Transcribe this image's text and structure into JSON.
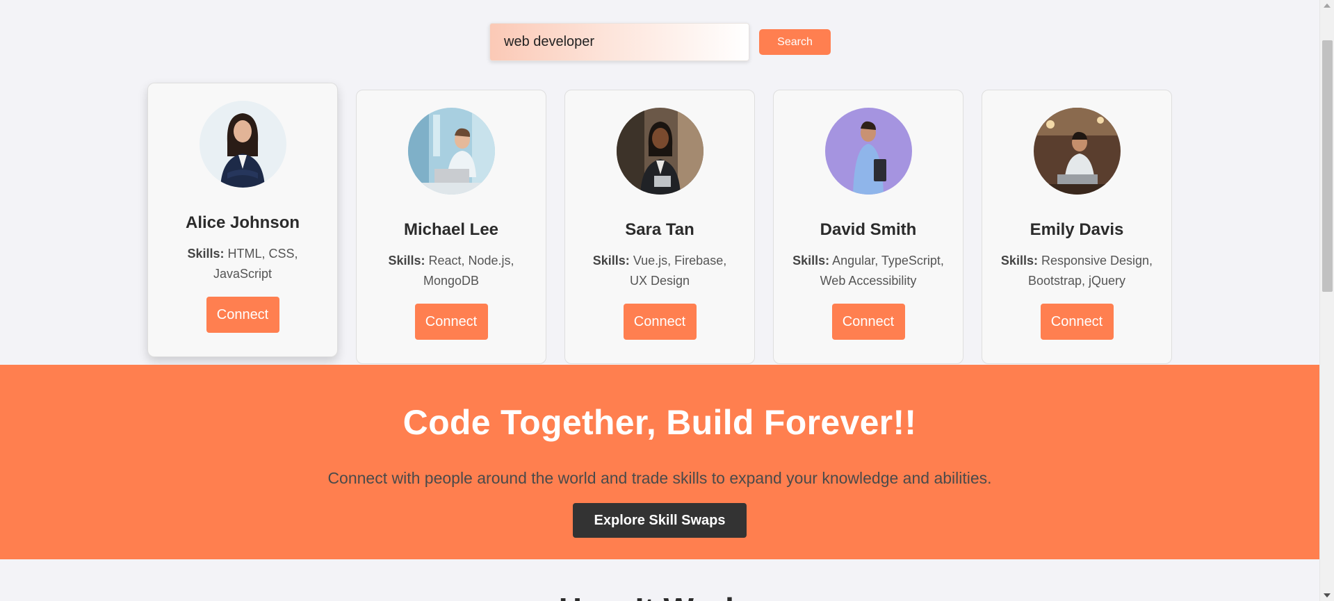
{
  "search": {
    "value": "web developer",
    "button_label": "Search"
  },
  "profiles": [
    {
      "name": "Alice Johnson",
      "skills_label": "Skills:",
      "skills": "HTML, CSS, JavaScript",
      "button_label": "Connect",
      "avatar_icon": "woman-business-suit-avatar",
      "avatar_bg": "#e9f0f4"
    },
    {
      "name": "Michael Lee",
      "skills_label": "Skills:",
      "skills": "React, Node.js, MongoDB",
      "button_label": "Connect",
      "avatar_icon": "man-laptop-office-avatar",
      "avatar_bg": "#a8cfe0"
    },
    {
      "name": "Sara Tan",
      "skills_label": "Skills:",
      "skills": "Vue.js, Firebase, UX Design",
      "button_label": "Connect",
      "avatar_icon": "woman-tablet-avatar",
      "avatar_bg": "#6b5848"
    },
    {
      "name": "David Smith",
      "skills_label": "Skills:",
      "skills": "Angular, TypeScript, Web Accessibility",
      "button_label": "Connect",
      "avatar_icon": "man-purple-backdrop-avatar",
      "avatar_bg": "#a594e0"
    },
    {
      "name": "Emily Davis",
      "skills_label": "Skills:",
      "skills": "Responsive Design, Bootstrap, jQuery",
      "button_label": "Connect",
      "avatar_icon": "man-cafe-laptop-avatar",
      "avatar_bg": "#5a3e2e"
    }
  ],
  "hero": {
    "title": "Code Together, Build Forever!!",
    "subtitle": "Connect with people around the world and trade skills to expand your knowledge and abilities.",
    "button_label": "Explore Skill Swaps"
  },
  "next_section": {
    "title": "How It Works"
  },
  "colors": {
    "accent": "#ff7f50",
    "hero_bg": "#ff7f4f",
    "dark_button": "#333333",
    "page_bg": "#f3f3f7"
  }
}
